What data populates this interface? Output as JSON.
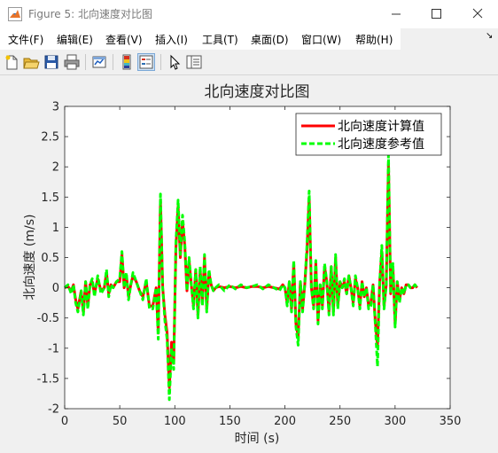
{
  "window": {
    "title": "Figure 5: 北向速度对比图"
  },
  "menu": {
    "items": [
      "文件(F)",
      "编辑(E)",
      "查看(V)",
      "插入(I)",
      "工具(T)",
      "桌面(D)",
      "窗口(W)",
      "帮助(H)"
    ]
  },
  "toolbar": {
    "icons": [
      "new-figure-icon",
      "open-file-icon",
      "save-icon",
      "print-icon",
      "link-plot-icon",
      "colorbar-icon",
      "legend-icon",
      "edit-plot-arrow-icon",
      "property-inspector-icon"
    ]
  },
  "colors": {
    "calc": "#ff0000",
    "ref": "#00ff00"
  },
  "chart_data": {
    "type": "line",
    "title": "北向速度对比图",
    "xlabel": "时间 (s)",
    "ylabel": "北向速度 (m/s)",
    "xlim": [
      0,
      350
    ],
    "ylim": [
      -2,
      3
    ],
    "xticks": [
      0,
      50,
      100,
      150,
      200,
      250,
      300,
      350
    ],
    "yticks": [
      -2,
      -1.5,
      -1,
      -0.5,
      0,
      0.5,
      1,
      1.5,
      2,
      2.5,
      3
    ],
    "grid": false,
    "legend_position": "top-right",
    "x": [
      0,
      3,
      6,
      8,
      10,
      12,
      15,
      17,
      19,
      21,
      23,
      25,
      27,
      30,
      33,
      36,
      38,
      40,
      42,
      44,
      47,
      50,
      52,
      54,
      56,
      58,
      60,
      62,
      65,
      68,
      71,
      74,
      77,
      80,
      83,
      85,
      87,
      89,
      91,
      93,
      95,
      97,
      99,
      101,
      103,
      105,
      107,
      109,
      111,
      113,
      115,
      117,
      119,
      121,
      123,
      125,
      127,
      129,
      131,
      133,
      135,
      137,
      140,
      145,
      150,
      155,
      160,
      165,
      170,
      175,
      180,
      185,
      190,
      195,
      198,
      200,
      202,
      204,
      206,
      208,
      210,
      212,
      214,
      216,
      218,
      220,
      222,
      224,
      226,
      228,
      230,
      232,
      234,
      236,
      238,
      240,
      242,
      244,
      246,
      248,
      250,
      252,
      254,
      256,
      258,
      260,
      262,
      264,
      266,
      268,
      270,
      272,
      274,
      276,
      278,
      280,
      282,
      284,
      286,
      288,
      290,
      292,
      294,
      296,
      298,
      300,
      302,
      304,
      306,
      308,
      310,
      312,
      314,
      316,
      318,
      320
    ],
    "series": [
      {
        "name": "北向速度计算值",
        "style": "solid",
        "values": [
          0.0,
          0.02,
          -0.05,
          0.05,
          -0.2,
          -0.35,
          -0.05,
          -0.4,
          0.1,
          -0.3,
          0.05,
          0.1,
          -0.1,
          0.15,
          -0.05,
          0.0,
          0.25,
          -0.1,
          0.05,
          0.0,
          0.1,
          0.1,
          0.55,
          0.0,
          0.2,
          -0.15,
          0.05,
          0.2,
          0.1,
          -0.05,
          -0.15,
          0.1,
          -0.3,
          -0.3,
          0.0,
          -0.75,
          1.45,
          0.0,
          -0.45,
          -0.75,
          -1.65,
          -0.9,
          -1.25,
          0.65,
          1.35,
          0.5,
          1.1,
          0.7,
          -0.05,
          0.45,
          0.05,
          -0.3,
          0.3,
          -0.45,
          0.3,
          -0.25,
          0.5,
          -0.35,
          0.25,
          0.05,
          -0.05,
          0.0,
          0.02,
          0.0,
          0.02,
          0.0,
          0.02,
          0.0,
          0.02,
          0.02,
          0.0,
          0.02,
          0.0,
          -0.02,
          0.05,
          0.0,
          -0.25,
          0.1,
          -0.35,
          0.4,
          -0.6,
          -0.8,
          0.1,
          -0.35,
          0.05,
          0.6,
          1.5,
          0.0,
          -0.3,
          0.4,
          -0.55,
          0.05,
          -0.3,
          0.35,
          0.1,
          -0.4,
          0.35,
          -0.4,
          0.5,
          -0.3,
          0.1,
          0.0,
          0.1,
          -0.1,
          0.2,
          0.0,
          -0.25,
          0.15,
          0.0,
          -0.3,
          0.1,
          -0.15,
          0.0,
          -0.3,
          -0.25,
          0.05,
          -0.55,
          -0.95,
          0.1,
          0.6,
          -0.3,
          0.05,
          2.05,
          -0.1,
          0.35,
          -0.6,
          0.1,
          -0.2,
          0.0,
          -0.1,
          0.05,
          0.05,
          0.0,
          0.0,
          0.05,
          0.0
        ],
        "color": "#ff0000"
      },
      {
        "name": "北向速度参考值",
        "style": "dashed",
        "values": [
          0.0,
          0.05,
          -0.1,
          0.05,
          -0.25,
          -0.4,
          -0.05,
          -0.45,
          0.1,
          -0.35,
          0.05,
          0.15,
          -0.15,
          0.2,
          -0.1,
          0.0,
          0.3,
          -0.15,
          0.05,
          0.0,
          0.1,
          0.15,
          0.6,
          0.0,
          0.25,
          -0.2,
          0.05,
          0.25,
          0.1,
          -0.05,
          -0.2,
          0.15,
          -0.35,
          -0.35,
          0.0,
          -0.85,
          1.55,
          0.0,
          -0.55,
          -0.85,
          -1.85,
          -1.0,
          -1.35,
          0.75,
          1.45,
          0.55,
          1.2,
          0.75,
          -0.05,
          0.5,
          0.05,
          -0.35,
          0.3,
          -0.5,
          0.35,
          -0.3,
          0.55,
          -0.4,
          0.3,
          0.05,
          -0.05,
          0.0,
          0.05,
          -0.05,
          0.05,
          -0.02,
          0.05,
          0.0,
          0.02,
          0.05,
          -0.02,
          0.05,
          0.0,
          -0.05,
          0.05,
          0.0,
          -0.3,
          0.1,
          -0.4,
          0.45,
          -0.65,
          -0.95,
          0.1,
          -0.4,
          0.05,
          0.7,
          1.6,
          0.0,
          -0.35,
          0.45,
          -0.6,
          0.05,
          -0.35,
          0.4,
          0.1,
          -0.45,
          0.35,
          -0.45,
          0.55,
          -0.35,
          0.1,
          0.0,
          0.15,
          -0.1,
          0.2,
          0.0,
          -0.3,
          0.2,
          0.0,
          -0.35,
          0.1,
          -0.15,
          0.0,
          -0.35,
          -0.3,
          0.05,
          -0.6,
          -1.3,
          0.1,
          0.7,
          -0.35,
          0.05,
          2.2,
          -0.1,
          0.4,
          -0.65,
          0.1,
          -0.25,
          0.0,
          -0.1,
          0.05,
          0.05,
          0.0,
          0.0,
          0.05,
          0.0
        ],
        "color": "#00ff00"
      }
    ]
  }
}
